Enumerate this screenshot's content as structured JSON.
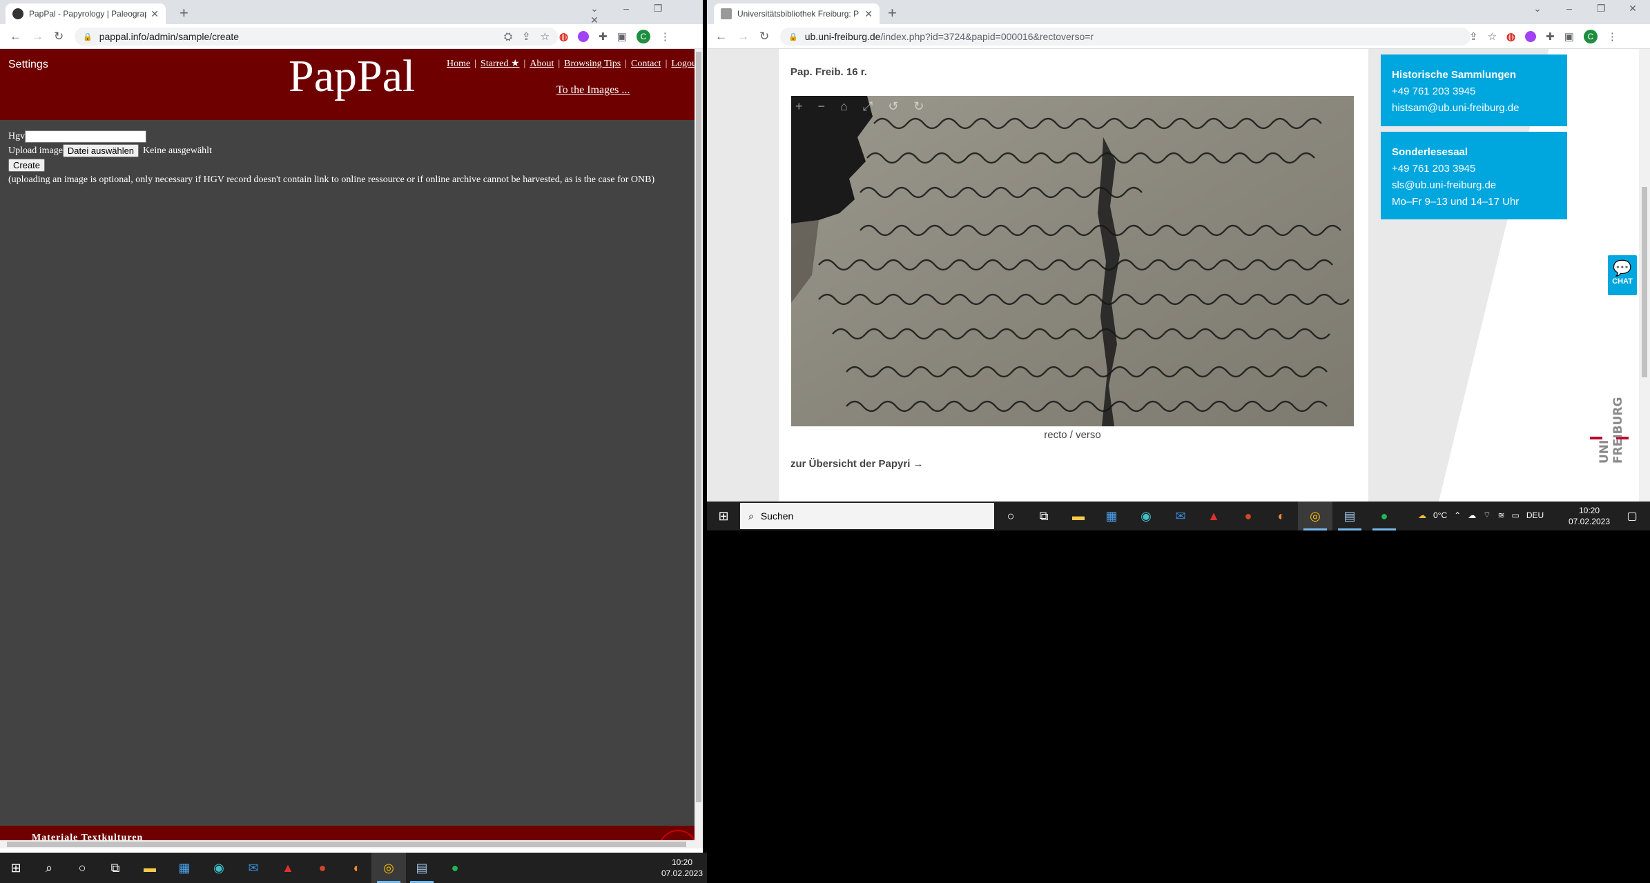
{
  "left_browser": {
    "tab_title": "PapPal - Papyrology | Paleograph",
    "tab_close": "✕",
    "new_tab": "+",
    "url": "pappal.info/admin/sample/create",
    "page": {
      "settings": "Settings",
      "logo": "PapPal",
      "nav": [
        "Home",
        "Starred ★",
        "About",
        "Browsing Tips",
        "Contact",
        "Logout"
      ],
      "nav_separator": "|",
      "to_images": "To the Images ...",
      "form": {
        "hgv_label": "Hgv",
        "hgv_value": "",
        "upload_label": "Upload image",
        "choose_file_button": "Datei auswählen",
        "no_file_text": "Keine ausgewählt",
        "create_button": "Create",
        "note": "(uploading an image is optional, only necessary if HGV record doesn't contain link to online ressource or if online archive cannot be harvested, as is the case for ONB)"
      },
      "footer_text": "Materiale Textkulturen"
    }
  },
  "right_browser": {
    "tab_title": "Universitätsbibliothek Freiburg: P",
    "tab_close": "✕",
    "new_tab": "+",
    "url_host": "ub.uni-freiburg.de",
    "url_path": "/index.php?id=3724&papid=000016&rectoverso=r",
    "page": {
      "signature": "Pap. Freib. 16 r.",
      "caption": "recto / verso",
      "overview_link": "zur Übersicht der Papyri →",
      "infobox_1": {
        "title": "Historische Sammlungen",
        "phone": "+49 761 203 3945",
        "email": "histsam@ub.uni-freiburg.de"
      },
      "infobox_2": {
        "title": "Sonderlesesaal",
        "phone": "+49 761 203 3945",
        "email": "sls@ub.uni-freiburg.de",
        "hours": "Mo–Fr 9–13 und 14–17 Uhr"
      },
      "chat_label": "CHAT",
      "logo_text_uni": "UNI",
      "logo_text_freiburg": "FREIBURG"
    }
  },
  "taskbar_right": {
    "search_placeholder": "Suchen",
    "weather": "0°C",
    "language": "DEU",
    "time": "10:20",
    "date": "07.02.2023"
  },
  "taskbar_left": {
    "time": "10:20",
    "date": "07.02.2023"
  },
  "colors": {
    "pappal_red": "#6e0000",
    "pappal_grey": "#434343",
    "uni_blue": "#00a6de"
  }
}
